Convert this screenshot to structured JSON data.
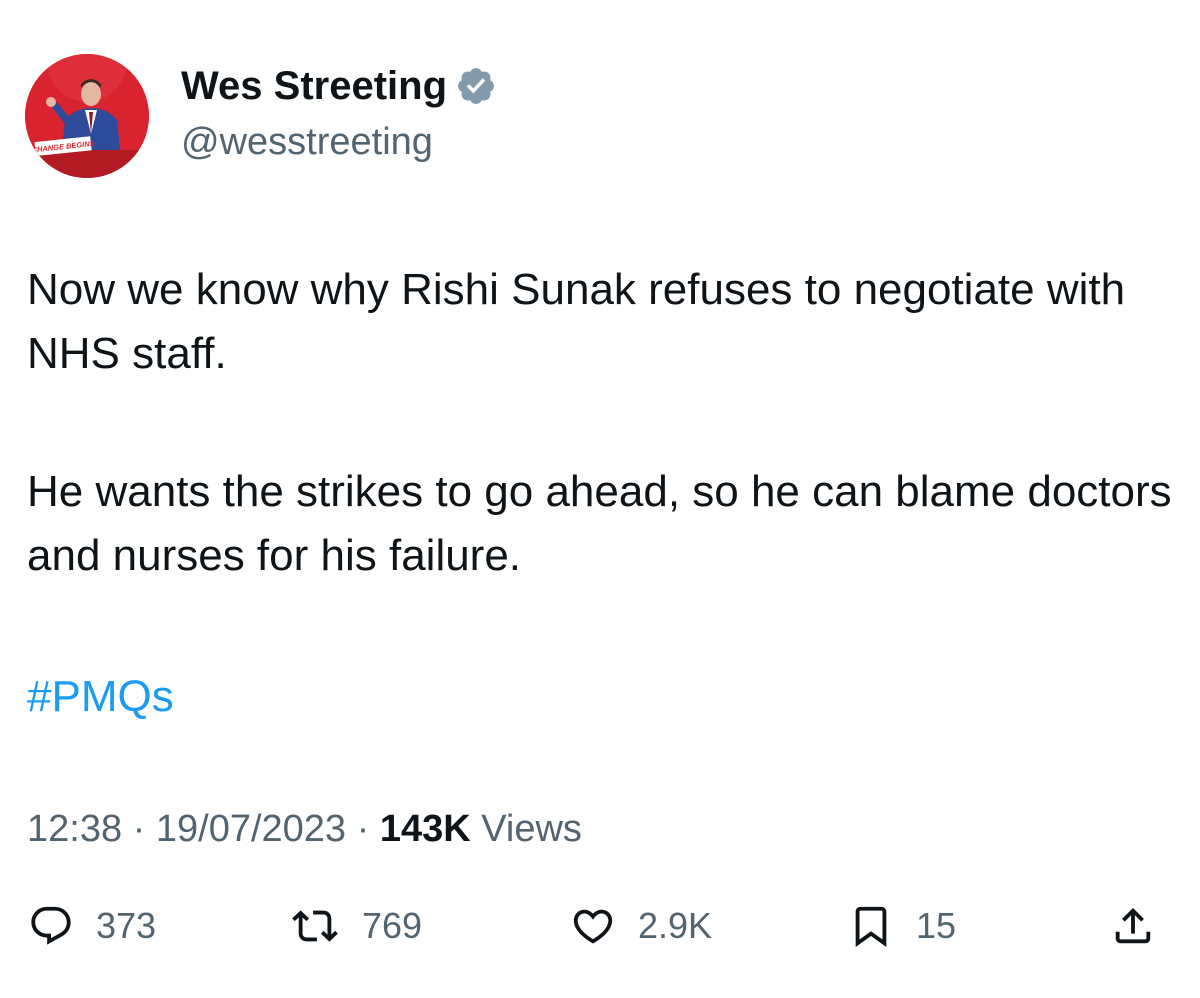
{
  "author": {
    "display_name": "Wes Streeting",
    "handle": "@wesstreeting",
    "verified_icon": "verified-badge-icon",
    "avatar_banner_text": "CHANGE BEGINS"
  },
  "tweet": {
    "paragraphs": [
      "Now we know why Rishi Sunak refuses to negotiate with NHS staff.",
      "He wants the strikes to go ahead, so he can blame doctors and nurses for his failure."
    ],
    "hashtag": "#PMQs"
  },
  "meta": {
    "time": "12:38",
    "separator": "·",
    "date": "19/07/2023",
    "views_count": "143K",
    "views_label": "Views"
  },
  "actions": {
    "reply_count": "373",
    "retweet_count": "769",
    "like_count": "2.9K",
    "bookmark_count": "15"
  },
  "colors": {
    "text": "#0f1419",
    "secondary": "#536471",
    "link": "#1d9bf0",
    "verified": "#829aab",
    "avatar_bg": "#d9232e"
  }
}
